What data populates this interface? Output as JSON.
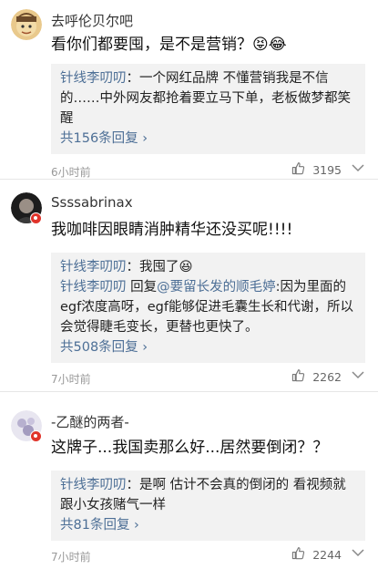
{
  "comments": [
    {
      "username": "去呼伦贝尔吧",
      "text": "看你们都要囤，是不是营销？😝😂",
      "replies": [
        {
          "name": "针线李叨叨",
          "sep": "：",
          "text": "一个网红品牌 不懂营销我是不信的……中外网友都抢着要立马下单，老板做梦都笑醒"
        }
      ],
      "more": "共156条回复 ›",
      "time": "6小时前",
      "likes": "3195"
    },
    {
      "username": "Ssssabrinax",
      "text": "我咖啡因眼睛消肿精华还没买呢!!!!",
      "replies": [
        {
          "name": "针线李叨叨",
          "sep": "：",
          "text": "我囤了😆"
        },
        {
          "name": "针线李叨叨",
          "sep": " 回复",
          "mention": "@要留长发的顺毛婷",
          "text": ":因为里面的egf浓度高呀，egf能够促进毛囊生长和代谢，所以会觉得睫毛变长，更替也更快了。"
        }
      ],
      "more": "共508条回复 ›",
      "time": "7小时前",
      "likes": "2262"
    },
    {
      "username": "-乙醚的两者-",
      "text": "这牌子...我国卖那么好...居然要倒闭？？",
      "replies": [
        {
          "name": "针线李叨叨",
          "sep": "：",
          "text": "是啊 估计不会真的倒闭的 看视频就跟小女孩赌气一样"
        }
      ],
      "more": "共81条回复 ›",
      "time": "7小时前",
      "likes": "2244"
    }
  ],
  "icons": {
    "like": "thumbs-up-icon",
    "more": "more-options-icon",
    "badge": "verified-badge-icon"
  },
  "colors": {
    "link": "#4d6f96",
    "badge": "#e0342b",
    "reply_bg": "#f2f2f2"
  }
}
